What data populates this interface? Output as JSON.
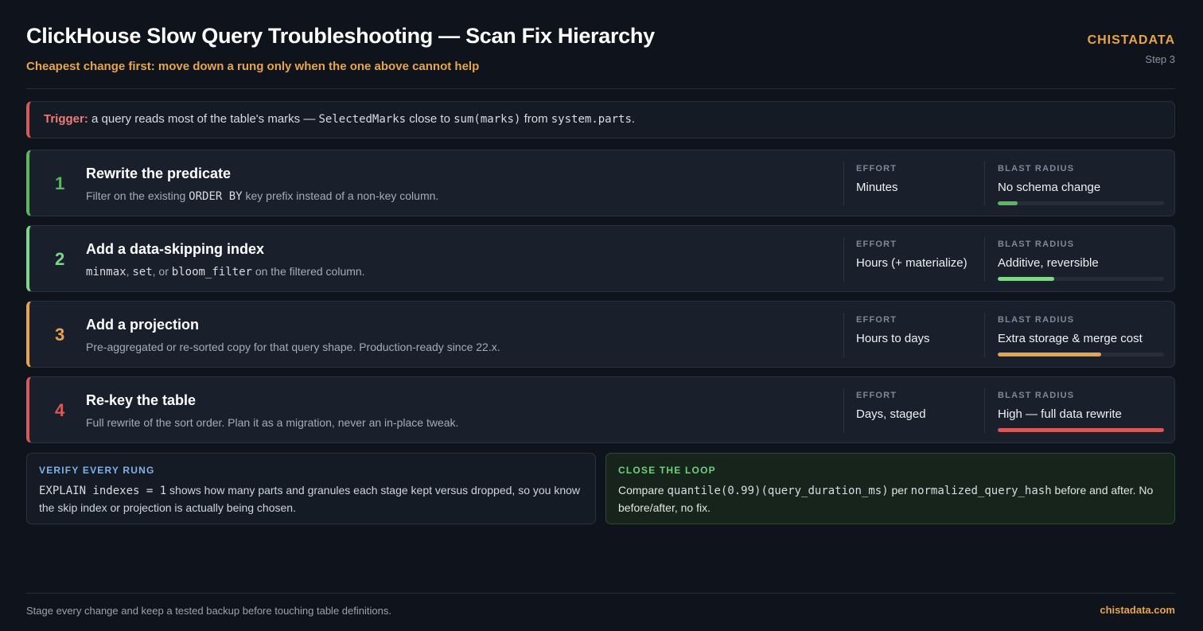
{
  "header": {
    "title": "ClickHouse Slow Query Troubleshooting — Scan Fix Hierarchy",
    "subtitle": "Cheapest change first: move down a rung only when the one above cannot help",
    "brand": "CHISTADATA",
    "step": "Step 3"
  },
  "trigger": {
    "label": "Trigger:",
    "text_1": " a query reads most of the table's marks — ",
    "code_1": "SelectedMarks",
    "text_2": " close to ",
    "code_2": "sum(marks)",
    "text_3": " from ",
    "code_3": "system.parts",
    "text_4": "."
  },
  "labels": {
    "effort": "EFFORT",
    "blast": "BLAST RADIUS"
  },
  "rungs": [
    {
      "num": "1",
      "title": "Rewrite the predicate",
      "desc_parts": [
        "Filter on the existing ",
        "ORDER BY",
        " key prefix instead of a non-key column."
      ],
      "effort": "Minutes",
      "blast": "No schema change",
      "blast_level": 0.12,
      "color": "#5cb860"
    },
    {
      "num": "2",
      "title": "Add a data-skipping index",
      "desc_parts": [
        "minmax",
        ", ",
        "set",
        ", or ",
        "bloom_filter",
        " on the filtered column."
      ],
      "effort": "Hours (+ materialize)",
      "blast": "Additive, reversible",
      "blast_level": 0.34,
      "color": "#7fd68a"
    },
    {
      "num": "3",
      "title": "Add a projection",
      "desc": "Pre-aggregated or re-sorted copy for that query shape. Production-ready since 22.x.",
      "effort": "Hours to days",
      "blast": "Extra storage & merge cost",
      "blast_level": 0.62,
      "color": "#e8a44a"
    },
    {
      "num": "4",
      "title": "Re-key the table",
      "desc": "Full rewrite of the sort order. Plan it as a migration, never an in-place tweak.",
      "effort": "Days, staged",
      "blast": "High — full data rewrite",
      "blast_level": 1.0,
      "color": "#d45a5a"
    }
  ],
  "verify": {
    "label": "VERIFY EVERY RUNG",
    "code": "EXPLAIN indexes = 1",
    "text": " shows how many parts and granules each stage kept versus dropped, so you know the skip index or projection is actually being chosen."
  },
  "close_loop": {
    "label": "CLOSE THE LOOP",
    "text_1": "Compare ",
    "code_1": "quantile(0.99)(query_duration_ms)",
    "text_2": " per ",
    "code_2": "normalized_query_hash",
    "text_3": " before and after. No before/after, no fix."
  },
  "footer": {
    "note": "Stage every change and keep a tested backup before touching table definitions.",
    "link": "chistadata.com"
  }
}
